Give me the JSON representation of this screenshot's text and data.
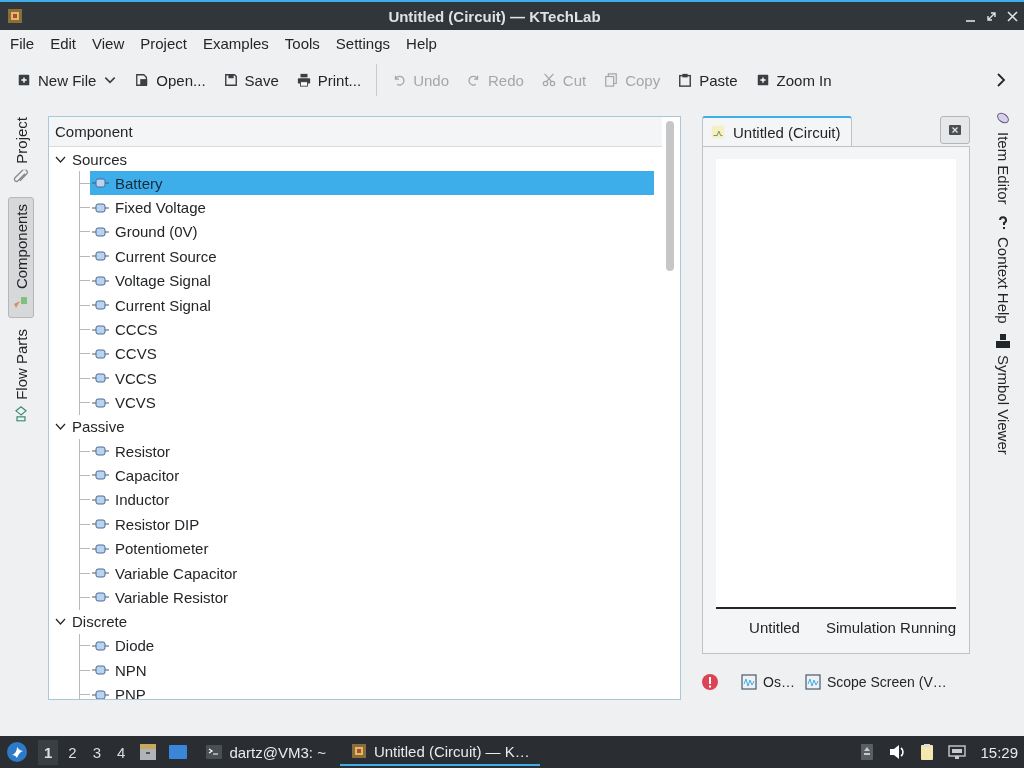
{
  "window": {
    "title": "Untitled (Circuit) — KTechLab"
  },
  "menu": [
    "File",
    "Edit",
    "View",
    "Project",
    "Examples",
    "Tools",
    "Settings",
    "Help"
  ],
  "toolbar": [
    {
      "label": "New File",
      "disabled": false,
      "has_menu": true
    },
    {
      "label": "Open...",
      "disabled": false,
      "has_menu": false
    },
    {
      "label": "Save",
      "disabled": false,
      "has_menu": false
    },
    {
      "label": "Print...",
      "disabled": false,
      "has_menu": false
    },
    {
      "label": "Undo",
      "disabled": true,
      "has_menu": false
    },
    {
      "label": "Redo",
      "disabled": true,
      "has_menu": false
    },
    {
      "label": "Cut",
      "disabled": true,
      "has_menu": false
    },
    {
      "label": "Copy",
      "disabled": true,
      "has_menu": false
    },
    {
      "label": "Paste",
      "disabled": false,
      "has_menu": false
    },
    {
      "label": "Zoom In",
      "disabled": false,
      "has_menu": false
    }
  ],
  "left_tabs": [
    {
      "label": "Project",
      "selected": false
    },
    {
      "label": "Components",
      "selected": true
    },
    {
      "label": "Flow Parts",
      "selected": false
    }
  ],
  "component_tree": {
    "header": "Component",
    "categories": [
      {
        "label": "Sources",
        "expanded": true,
        "children": [
          {
            "label": "Battery",
            "selected": true
          },
          {
            "label": "Fixed Voltage",
            "selected": false
          },
          {
            "label": "Ground (0V)",
            "selected": false
          },
          {
            "label": "Current Source",
            "selected": false
          },
          {
            "label": "Voltage Signal",
            "selected": false
          },
          {
            "label": "Current Signal",
            "selected": false
          },
          {
            "label": "CCCS",
            "selected": false
          },
          {
            "label": "CCVS",
            "selected": false
          },
          {
            "label": "VCCS",
            "selected": false
          },
          {
            "label": "VCVS",
            "selected": false
          }
        ]
      },
      {
        "label": "Passive",
        "expanded": true,
        "children": [
          {
            "label": "Resistor",
            "selected": false
          },
          {
            "label": "Capacitor",
            "selected": false
          },
          {
            "label": "Inductor",
            "selected": false
          },
          {
            "label": "Resistor DIP",
            "selected": false
          },
          {
            "label": "Potentiometer",
            "selected": false
          },
          {
            "label": "Variable Capacitor",
            "selected": false
          },
          {
            "label": "Variable Resistor",
            "selected": false
          }
        ]
      },
      {
        "label": "Discrete",
        "expanded": true,
        "children": [
          {
            "label": "Diode",
            "selected": false
          },
          {
            "label": "NPN",
            "selected": false
          },
          {
            "label": "PNP",
            "selected": false
          }
        ]
      }
    ]
  },
  "document": {
    "tab": "Untitled (Circuit)",
    "status": [
      "Untitled",
      "Simulation Running"
    ]
  },
  "bottom_tools": [
    "Os…",
    "Scope Screen (V…"
  ],
  "right_tabs": [
    "Item Editor",
    "Context Help",
    "Symbol Viewer"
  ],
  "taskbar": {
    "workspaces": [
      {
        "label": "1",
        "selected": true
      },
      {
        "label": "2",
        "selected": false
      },
      {
        "label": "3",
        "selected": false
      },
      {
        "label": "4",
        "selected": false
      }
    ],
    "tasks": [
      {
        "label": "dartz@VM3: ~",
        "selected": false
      },
      {
        "label": "Untitled (Circuit) — K…",
        "selected": true
      }
    ],
    "clock": "15:29"
  }
}
